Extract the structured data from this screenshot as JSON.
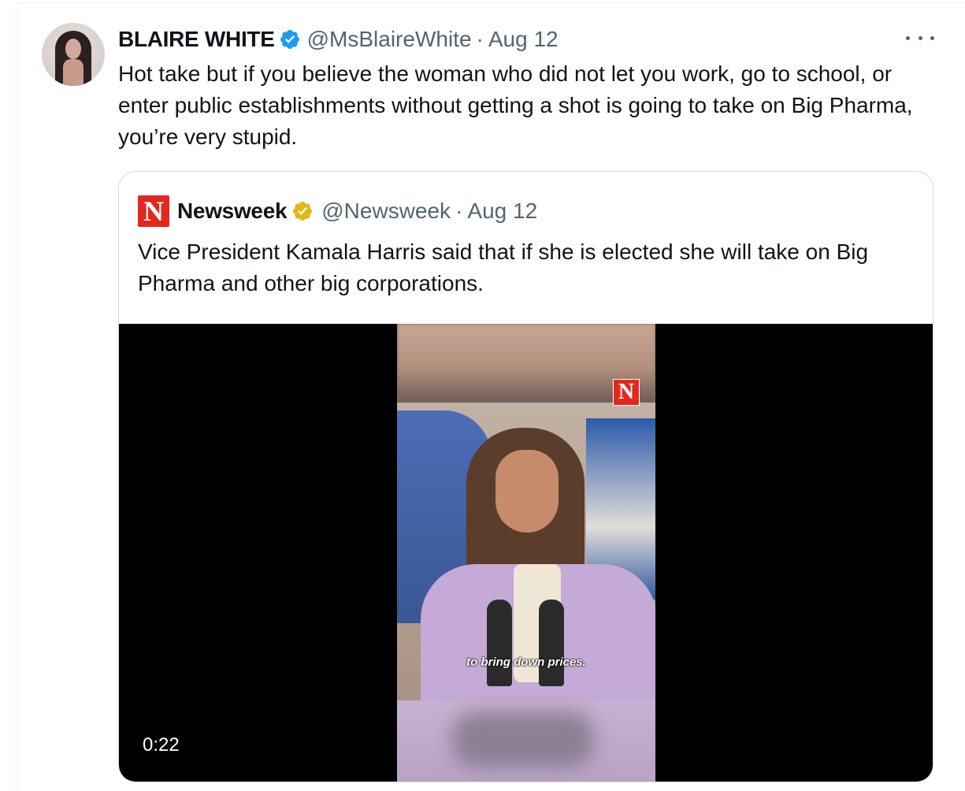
{
  "tweet": {
    "author_name": "BLAIRE WHITE",
    "handle": "@MsBlaireWhite",
    "separator": "·",
    "date": "Aug 12",
    "text": "Hot take but if you believe the woman who did not let you work, go to school, or enter public establishments without getting a shot is going to take on Big Pharma, you’re very stupid.",
    "verified_badge": "blue-check-icon",
    "more_icon": "more-options-icon"
  },
  "quote": {
    "logo_letter": "N",
    "author_name": "Newsweek",
    "handle": "@Newsweek",
    "separator": "·",
    "date": "Aug 12",
    "text": "Vice President Kamala Harris said that if she is elected she will take on Big Pharma and other big corporations.",
    "verified_badge": "gold-check-icon",
    "video": {
      "watermark_letter": "N",
      "caption": "to bring down prices.",
      "duration": "0:22"
    }
  },
  "colors": {
    "text_primary": "#0f1419",
    "text_secondary": "#536471",
    "verified_blue": "#1d9bf0",
    "verified_gold": "#e2b719",
    "newsweek_red": "#e4271e",
    "border": "#cfd9de"
  }
}
